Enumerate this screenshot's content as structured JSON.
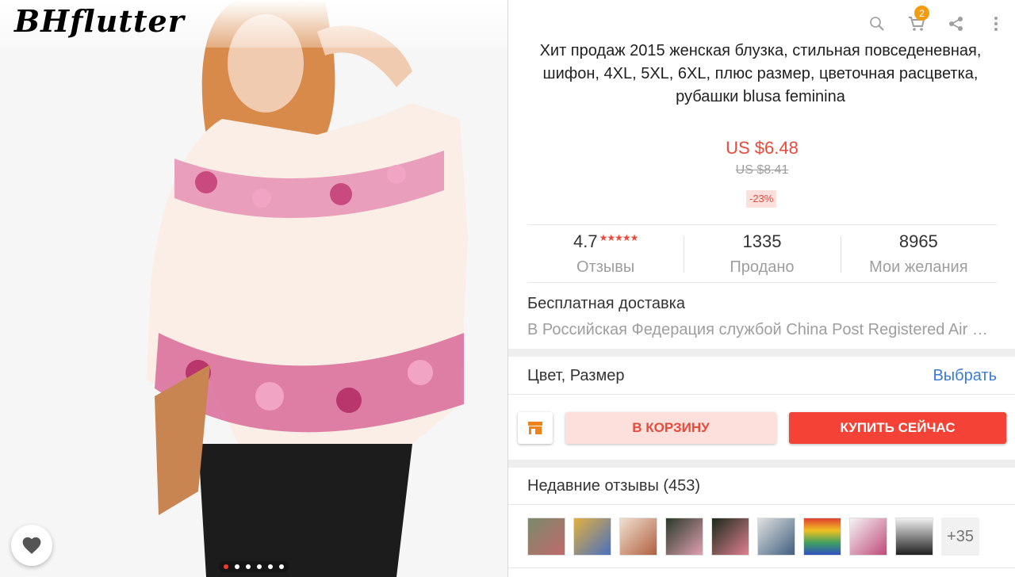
{
  "gallery": {
    "watermark": "BHflutter",
    "slide_count": 6,
    "active_slide": 0
  },
  "toolbar": {
    "icons": [
      "search-icon",
      "cart-icon",
      "share-icon",
      "more-icon"
    ],
    "cart_count": "2"
  },
  "product": {
    "title": "Хит продаж 2015 женская блузка, стильная повседеневная, шифон, 4XL, 5XL, 6XL, плюс размер, цветочная расцветка, рубашки blusa feminina",
    "price": "US $6.48",
    "old_price": "US $8.41",
    "discount": "-23%"
  },
  "stats": {
    "rating": "4.7",
    "stars": "★★★★★",
    "reviews_label": "Отзывы",
    "sold": "1335",
    "sold_label": "Продано",
    "wishes": "8965",
    "wishes_label": "Мои желания"
  },
  "shipping": {
    "title": "Бесплатная доставка",
    "description": "В Российская Федерация службой China Post Registered Air Mail"
  },
  "variant": {
    "label": "Цвет, Размер",
    "action": "Выбрать"
  },
  "actions": {
    "add_to_cart": "В КОРЗИНУ",
    "buy_now": "КУПИТЬ СЕЙЧАС"
  },
  "reviews": {
    "title": "Недавние отзывы (453)",
    "more": "+35",
    "thumb_count": 9
  },
  "colors": {
    "accent": "#e64b3c",
    "buy": "#f44336",
    "link": "#3a7bd5",
    "badge": "#f39c12"
  }
}
